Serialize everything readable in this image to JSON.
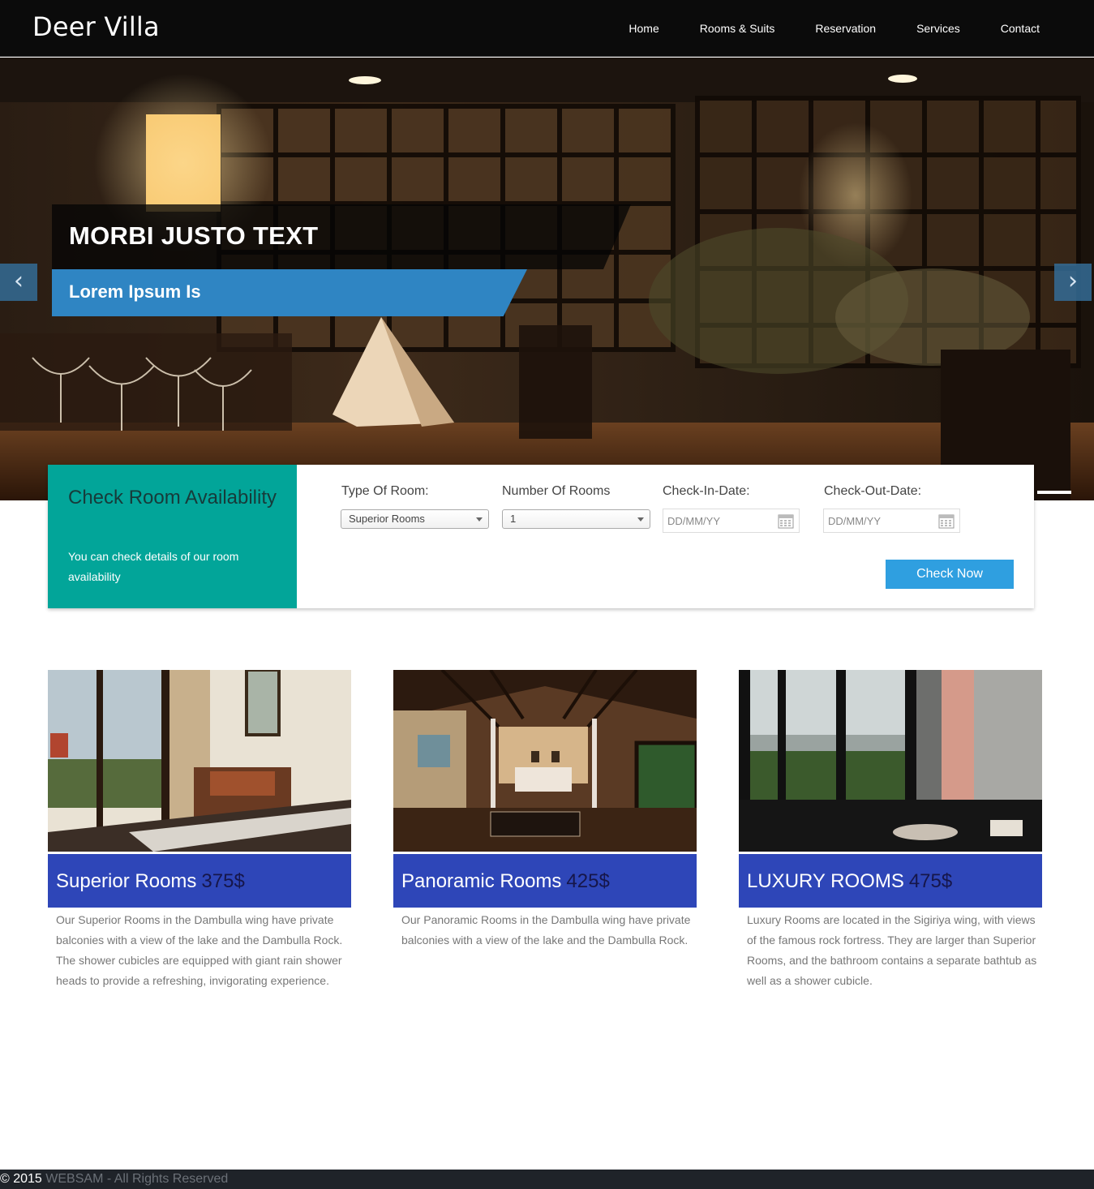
{
  "navbar": {
    "brand": "Deer Villa",
    "links": [
      "Home",
      "Rooms & Suits",
      "Reservation",
      "Services",
      "Contact"
    ]
  },
  "hero": {
    "title": "MORBI JUSTO TEXT",
    "subtitle": "Lorem Ipsum Is",
    "prev_icon": "chevron-left-icon",
    "next_icon": "chevron-right-icon",
    "prev_glyph": "‹",
    "next_glyph": "›"
  },
  "availability": {
    "title": "Check Room Availability",
    "description": "You can check details of our room availability",
    "room_type_label": "Type Of Room:",
    "room_type_value": "Superior Rooms",
    "room_count_label": "Number Of Rooms",
    "room_count_value": "1",
    "checkin_label": "Check-In-Date:",
    "checkin_placeholder": "DD/MM/YY",
    "checkout_label": "Check-Out-Date:",
    "checkout_placeholder": "DD/MM/YY",
    "button": "Check Now"
  },
  "rooms": [
    {
      "name": "Superior Rooms",
      "price": "375$",
      "description": "Our Superior Rooms in the Dambulla wing have private balconies with a view of the lake and the Dambulla Rock. The shower cubicles are equipped with giant rain shower heads to provide a refreshing, invigorating experience."
    },
    {
      "name": "Panoramic Rooms",
      "price": "425$",
      "description": "Our Panoramic Rooms in the Dambulla wing have private balconies with a view of the lake and the Dambulla Rock."
    },
    {
      "name": "LUXURY ROOMS",
      "price": "475$",
      "description": "Luxury Rooms are located in the Sigiriya wing, with views of the famous rock fortress. They are larger than Superior Rooms, and the bathroom contains a separate bathtub as well as a shower cubicle."
    }
  ],
  "footer": {
    "copyright": "© 2015",
    "brand": "WEBSAM",
    "rights": "- All Rights Reserved"
  },
  "colors": {
    "nav_bg": "#0b0b0b",
    "accent_blue": "#2f85c3",
    "teal": "#02a599",
    "button_blue": "#2f9fe0",
    "room_bar": "#2e46b8",
    "footer_bg": "#1f2329"
  }
}
